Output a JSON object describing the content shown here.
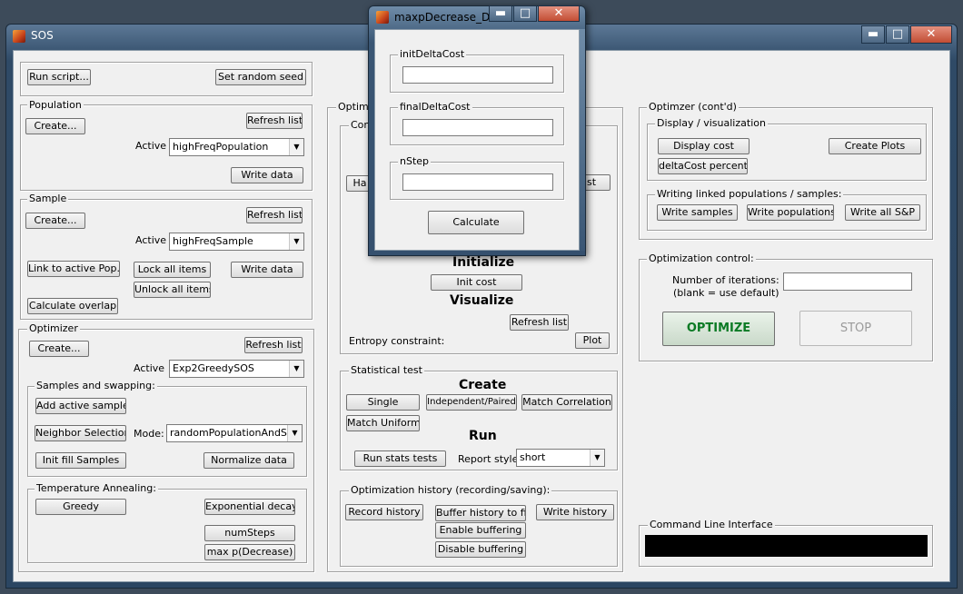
{
  "main_window": {
    "title": "SOS"
  },
  "dialog": {
    "title": "maxpDecrease_D...",
    "init_label": "initDeltaCost",
    "final_label": "finalDeltaCost",
    "nstep_label": "nStep",
    "calculate": "Calculate"
  },
  "window_buttons": {
    "minimize": "▬",
    "maximize": "□",
    "close": "✕"
  },
  "top": {
    "run_script": "Run script...",
    "set_seed": "Set random seed"
  },
  "population": {
    "legend": "Population",
    "create": "Create...",
    "refresh": "Refresh list",
    "active_label": "Active",
    "active_value": "highFreqPopulation",
    "write": "Write data"
  },
  "sample": {
    "legend": "Sample",
    "create": "Create...",
    "refresh": "Refresh list",
    "active_label": "Active",
    "active_value": "highFreqSample",
    "link": "Link to active Pop.",
    "lock": "Lock all items",
    "write": "Write data",
    "unlock": "Unlock all items",
    "overlap": "Calculate overlap"
  },
  "optimizer": {
    "legend": "Optimizer",
    "create": "Create...",
    "refresh": "Refresh list",
    "active_label": "Active",
    "active_value": "Exp2GreedySOS",
    "swap_legend": "Samples and swapping:",
    "add_sample": "Add active sample",
    "neighbor": "Neighbor Selection",
    "mode_label": "Mode:",
    "mode_value": "randomPopulationAndSa...",
    "init_fill": "Init fill Samples",
    "normalize": "Normalize data",
    "temp_legend": "Temperature Annealing:",
    "greedy": "Greedy",
    "exp_decay": "Exponential decay",
    "num_steps": "numSteps",
    "max_p": "max p(Decrease)"
  },
  "middle": {
    "legend": "Optimiz",
    "con_legend": "Con",
    "ha_btn": "Ha",
    "st_btn": "st",
    "initialize": "Initialize",
    "init_cost": "Init cost",
    "visualize": "Visualize",
    "refresh": "Refresh list",
    "entropy_label": "Entropy constraint:",
    "plot": "Plot",
    "stat_legend": "Statistical test",
    "create": "Create",
    "single": "Single",
    "indep": "Independent/Paired",
    "match_corr": "Match Correlation",
    "match_uniform": "Match Uniform",
    "run": "Run",
    "run_stats": "Run stats tests",
    "report_label": "Report style:",
    "report_value": "short",
    "history_legend": "Optimization history (recording/saving):",
    "record": "Record history",
    "buffer": "Buffer history to file",
    "write_hist": "Write history",
    "enable": "Enable buffering",
    "disable": "Disable buffering"
  },
  "right": {
    "legend": "Optimzer (cont'd)",
    "display_legend": "Display / visualization",
    "display_cost": "Display cost",
    "create_plots": "Create Plots",
    "deltacost": "deltaCost percentil...",
    "linked_legend": "Writing linked populations / samples:",
    "write_samples": "Write samples",
    "write_pops": "Write populations",
    "write_all": "Write all S&P",
    "optctrl_legend": "Optimization control:",
    "iterations_label": "Number of iterations:",
    "iterations_hint": "(blank = use default)",
    "optimize": "OPTIMIZE",
    "stop": "STOP",
    "cli_legend": "Command Line Interface"
  },
  "colors": {
    "optimize_text": "#0b7a24",
    "stop_text": "#9a9a9a",
    "cli_bg": "#000000"
  }
}
